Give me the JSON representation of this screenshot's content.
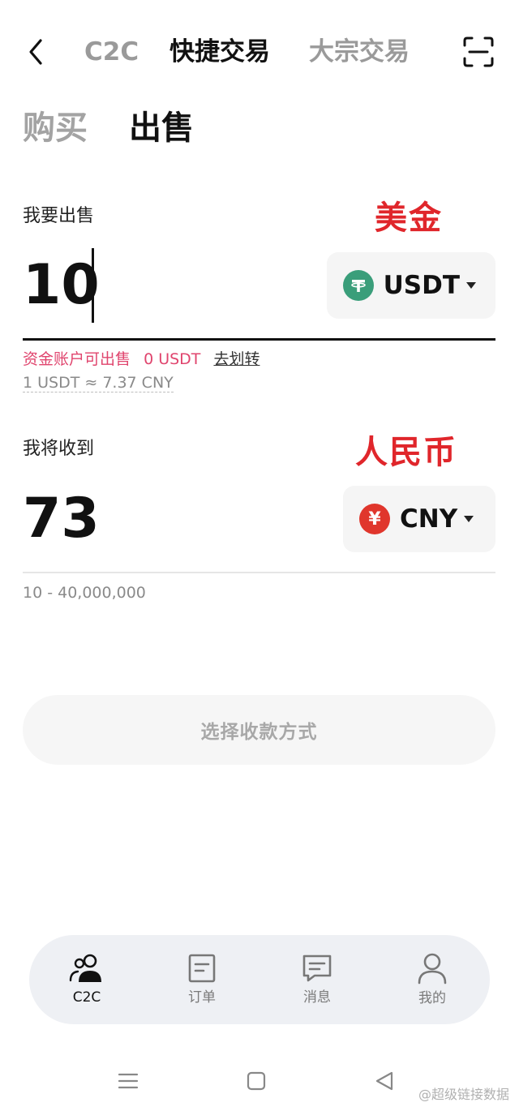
{
  "topnav": {
    "tabs": [
      "C2C",
      "快捷交易",
      "大宗交易"
    ],
    "active_index": 1
  },
  "side": {
    "buy": "购买",
    "sell": "出售",
    "active": "sell"
  },
  "sell_section": {
    "label": "我要出售",
    "annotation": "美金",
    "amount": "10",
    "currency": "USDT",
    "currency_icon": "tether-icon",
    "available_label": "资金账户可出售",
    "available_value": "0 USDT",
    "transfer_link": "去划转",
    "rate": "1 USDT ≈ 7.37 CNY"
  },
  "receive_section": {
    "label": "我将收到",
    "annotation": "人民币",
    "amount": "73",
    "currency": "CNY",
    "currency_symbol": "¥",
    "range": "10 - 40,000,000"
  },
  "cta": {
    "label": "选择收款方式"
  },
  "tabbar": {
    "items": [
      {
        "label": "C2C",
        "icon": "users-icon",
        "active": true
      },
      {
        "label": "订单",
        "icon": "order-icon",
        "active": false
      },
      {
        "label": "消息",
        "icon": "message-icon",
        "active": false
      },
      {
        "label": "我的",
        "icon": "profile-icon",
        "active": false
      }
    ]
  },
  "watermark": "@超级链接数据",
  "colors": {
    "accent_red": "#e0262b",
    "pink": "#e0456e",
    "usdt_green": "#3a9e7a",
    "cny_red": "#e0362c"
  }
}
